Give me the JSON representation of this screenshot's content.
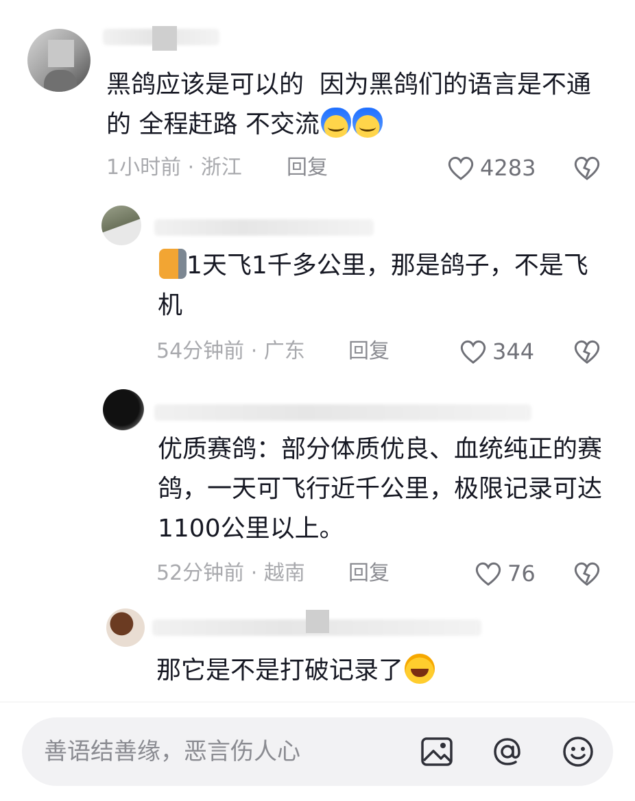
{
  "comments": [
    {
      "text": "黑鸽应该是可以的  因为黑鸽们的语言是不通的 全程赶路 不交流",
      "time_location": "1小时前 · 浙江",
      "reply_label": "回复",
      "likes": "4283",
      "emojis": [
        "blue-face-emoji",
        "blue-face-emoji"
      ]
    },
    {
      "text": "1天飞1千多公里，那是鸽子，不是飞机",
      "time_location": "54分钟前 · 广东",
      "reply_label": "回复",
      "likes": "344",
      "emojis": [
        "bear-emoji"
      ]
    },
    {
      "text": "优质赛鸽：部分体质优良、血统纯正的赛鸽，一天可飞行近千公里，极限记录可达1100公里以上。",
      "time_location": "52分钟前 · 越南",
      "reply_label": "回复",
      "likes": "76"
    },
    {
      "text": "那它是不是打破记录了",
      "emojis": [
        "laugh-cry-emoji"
      ]
    }
  ],
  "composer": {
    "placeholder": "善语结善缘，恶言伤人心",
    "icons": [
      "image-icon",
      "mention-icon",
      "emoji-icon"
    ]
  },
  "colors": {
    "text": "#161823",
    "meta": "#a8a9ad",
    "input_bg": "#f2f2f4"
  }
}
